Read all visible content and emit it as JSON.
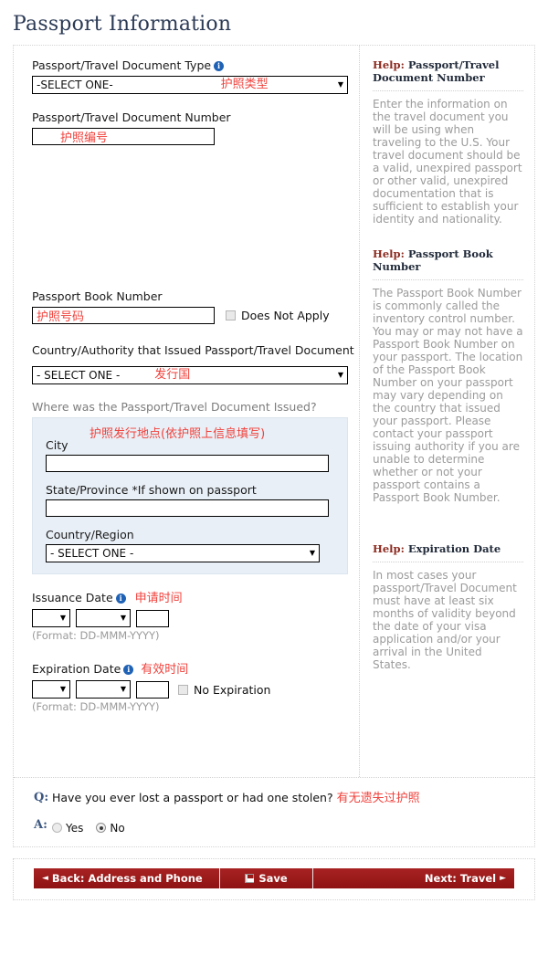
{
  "page": {
    "title": "Passport Information"
  },
  "form": {
    "doc_type": {
      "label": "Passport/Travel Document Type",
      "info_icon": "info-icon",
      "value": "-SELECT ONE-",
      "annotation": "护照类型"
    },
    "doc_number": {
      "label": "Passport/Travel Document Number",
      "value": "",
      "annotation": "护照编号"
    },
    "book_number": {
      "label": "Passport Book Number",
      "value": "",
      "annotation": "护照号码",
      "checkbox_label": "Does Not Apply",
      "checked": false
    },
    "issuing_country": {
      "label": "Country/Authority that Issued Passport/Travel Document",
      "value": "- SELECT ONE -",
      "annotation": "发行国"
    },
    "issued_where": {
      "label": "Where was the Passport/Travel Document Issued?",
      "annotation": "护照发行地点(依护照上信息填写)",
      "city_label": "City",
      "city_value": "",
      "state_label": "State/Province *If shown on passport",
      "state_value": "",
      "country_label": "Country/Region",
      "country_value": "- SELECT ONE -"
    },
    "issuance_date": {
      "label": "Issuance Date",
      "annotation": "申请时间",
      "day": "",
      "month": "",
      "year": "",
      "format_hint": "(Format: DD-MMM-YYYY)"
    },
    "expiration_date": {
      "label": "Expiration Date",
      "annotation": "有效时间",
      "day": "",
      "month": "",
      "year": "",
      "format_hint": "(Format: DD-MMM-YYYY)",
      "checkbox_label": "No Expiration",
      "checked": false
    }
  },
  "help": [
    {
      "word": "Help:",
      "title": " Passport/Travel Document Number",
      "body": "Enter the information on the travel document you will be using when traveling to the U.S. Your travel document should be a valid, unexpired passport or other valid, unexpired documentation that is sufficient to establish your identity and nationality."
    },
    {
      "word": "Help:",
      "title": " Passport Book Number",
      "body": "The Passport Book Number is commonly called the inventory control number. You may or may not have a Passport Book Number on your passport. The location of the Passport Book Number on your passport may vary depending on the country that issued your passport. Please contact your passport issuing authority if you are unable to determine whether or not your passport contains a Passport Book Number."
    },
    {
      "word": "Help:",
      "title": " Expiration Date",
      "body": "In most cases your passport/Travel Document must have at least six months of validity beyond the date of your visa application and/or your arrival in the United States."
    }
  ],
  "question": {
    "q_key": "Q:",
    "a_key": "A:",
    "text": "Have you ever lost a passport or had one stolen?",
    "annotation": "有无遗失过护照",
    "options": [
      {
        "label": "Yes",
        "selected": false
      },
      {
        "label": "No",
        "selected": true
      }
    ]
  },
  "footer": {
    "back_label": "Back: Address and Phone",
    "back_caret": "◄",
    "save_label": "Save",
    "save_icon": "floppy-disk-icon",
    "next_label": "Next: Travel",
    "next_caret": "►"
  },
  "colors": {
    "title": "#2b3a55",
    "annotation_red": "#f0423c",
    "help_word": "#8c2b20",
    "nav_red": "#9b1b1b",
    "subbox_blue": "#e8eff6"
  }
}
